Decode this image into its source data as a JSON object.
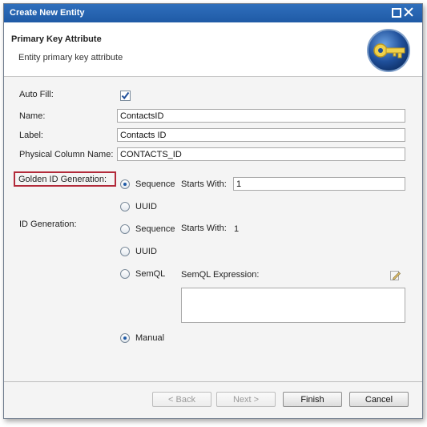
{
  "window": {
    "title": "Create New Entity"
  },
  "header": {
    "title": "Primary Key Attribute",
    "subtitle": "Entity primary key attribute",
    "icon": "key-icon"
  },
  "form": {
    "auto_fill": {
      "label": "Auto Fill:",
      "checked": true
    },
    "name": {
      "label": "Name:",
      "value": "ContactsID"
    },
    "label_field": {
      "label": "Label:",
      "value": "Contacts ID"
    },
    "physical_column": {
      "label": "Physical Column Name:",
      "value": "CONTACTS_ID"
    },
    "golden_id": {
      "label": "Golden ID Generation:",
      "options": {
        "sequence": "Sequence",
        "uuid": "UUID"
      },
      "selected": "Sequence",
      "starts_with_label": "Starts With:",
      "starts_with_value": "1"
    },
    "id_generation": {
      "label": "ID Generation:",
      "options": {
        "sequence": "Sequence",
        "uuid": "UUID",
        "semql": "SemQL",
        "manual": "Manual"
      },
      "selected": "Manual",
      "starts_with_label": "Starts With:",
      "starts_with_value": "1",
      "semql_expression_label": "SemQL Expression:"
    }
  },
  "buttons": {
    "back": "< Back",
    "next": "Next >",
    "finish": "Finish",
    "cancel": "Cancel"
  },
  "colors": {
    "titlebar": "#1f5aa6",
    "highlight": "#b22a3a",
    "radio_dot": "#1f5aa6"
  }
}
